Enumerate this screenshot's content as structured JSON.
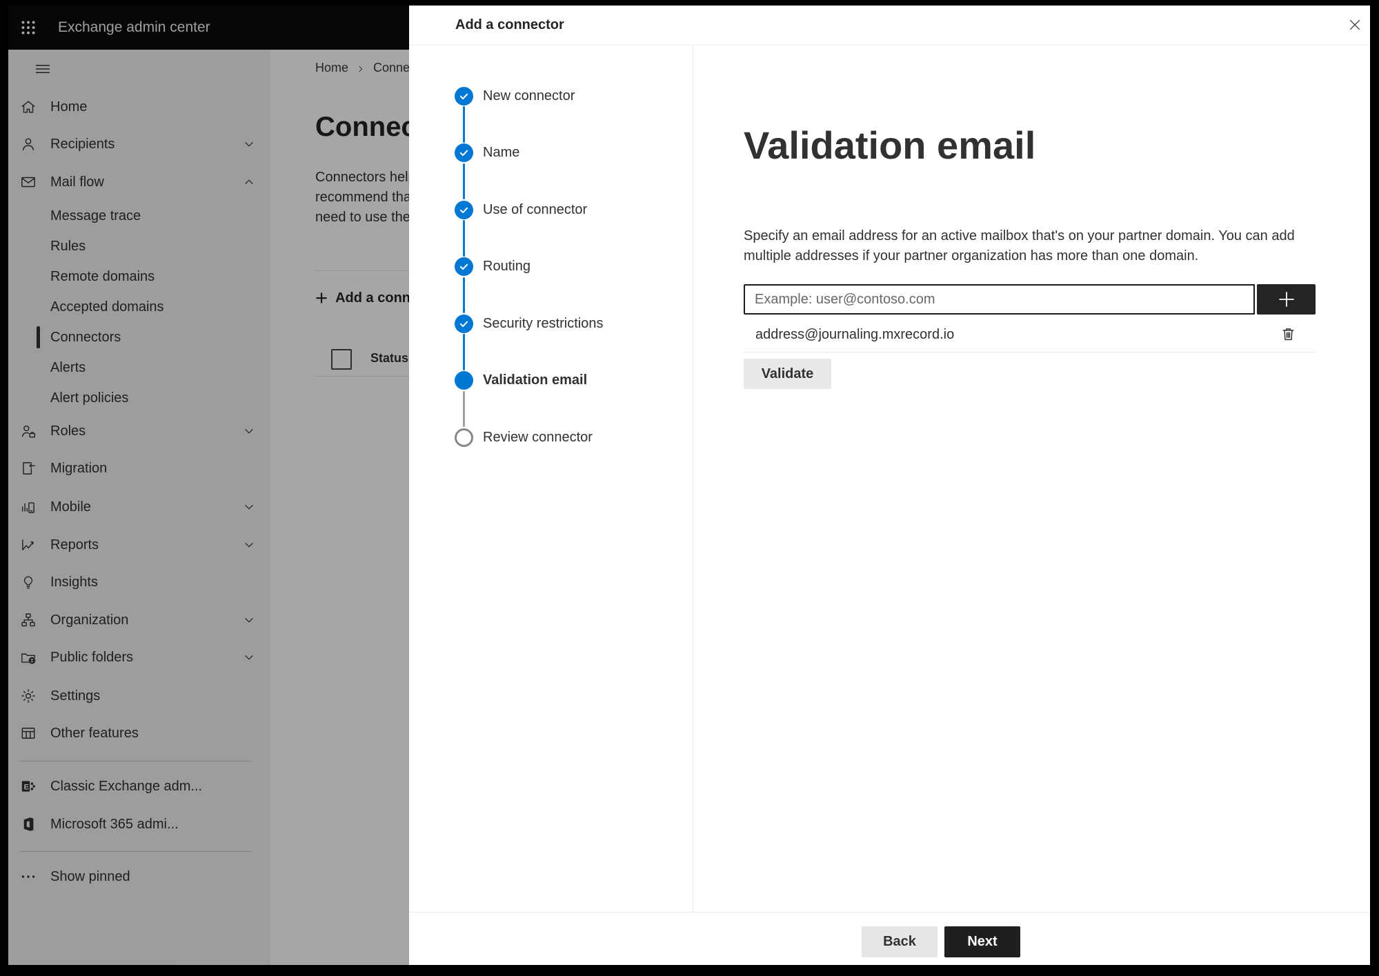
{
  "topbar": {
    "title": "Exchange admin center"
  },
  "sidebar": {
    "items": [
      {
        "label": "Home",
        "icon": "home-icon",
        "type": "main"
      },
      {
        "label": "Recipients",
        "icon": "recipients-icon",
        "type": "main",
        "chevron": "down"
      },
      {
        "label": "Mail flow",
        "icon": "mail-flow-icon",
        "type": "main",
        "chevron": "up"
      },
      {
        "label": "Message trace",
        "type": "sub"
      },
      {
        "label": "Rules",
        "type": "sub"
      },
      {
        "label": "Remote domains",
        "type": "sub"
      },
      {
        "label": "Accepted domains",
        "type": "sub"
      },
      {
        "label": "Connectors",
        "type": "sub",
        "selected": true
      },
      {
        "label": "Alerts",
        "type": "sub"
      },
      {
        "label": "Alert policies",
        "type": "sub"
      },
      {
        "label": "Roles",
        "icon": "roles-icon",
        "type": "main",
        "chevron": "down"
      },
      {
        "label": "Migration",
        "icon": "migration-icon",
        "type": "main"
      },
      {
        "label": "Mobile",
        "icon": "mobile-icon",
        "type": "main",
        "chevron": "down"
      },
      {
        "label": "Reports",
        "icon": "reports-icon",
        "type": "main",
        "chevron": "down"
      },
      {
        "label": "Insights",
        "icon": "insights-icon",
        "type": "main"
      },
      {
        "label": "Organization",
        "icon": "organization-icon",
        "type": "main",
        "chevron": "down"
      },
      {
        "label": "Public folders",
        "icon": "public-folders-icon",
        "type": "main",
        "chevron": "down"
      },
      {
        "label": "Settings",
        "icon": "settings-icon",
        "type": "main"
      },
      {
        "label": "Other features",
        "icon": "other-features-icon",
        "type": "main"
      }
    ],
    "footer_items": [
      {
        "label": "Classic Exchange adm...",
        "icon": "classic-exchange-icon"
      },
      {
        "label": "Microsoft 365 admi...",
        "icon": "microsoft-365-icon"
      },
      {
        "label": "Show pinned",
        "icon": "show-pinned-icon"
      }
    ]
  },
  "background_page": {
    "breadcrumb_home": "Home",
    "breadcrumb_current": "Connectors",
    "heading": "Connectors",
    "paragraph_lines": [
      "Connectors help route email",
      "recommend that you don't create",
      "need to use them for specific"
    ],
    "add_button_label": "Add a connector",
    "status_header": "Status"
  },
  "dialog": {
    "title": "Add a connector",
    "steps": [
      {
        "label": "New connector",
        "state": "completed"
      },
      {
        "label": "Name",
        "state": "completed"
      },
      {
        "label": "Use of connector",
        "state": "completed"
      },
      {
        "label": "Routing",
        "state": "completed"
      },
      {
        "label": "Security restrictions",
        "state": "completed"
      },
      {
        "label": "Validation email",
        "state": "current"
      },
      {
        "label": "Review connector",
        "state": "upcoming"
      }
    ],
    "content": {
      "heading": "Validation email",
      "description_line1": "Specify an email address for an active mailbox that's on your partner domain. You can add",
      "description_line2": "multiple addresses if your partner organization has more than one domain.",
      "input_placeholder": "Example: user@contoso.com",
      "email_address": "address@journaling.mxrecord.io",
      "validate_button": "Validate"
    },
    "footer": {
      "back_button": "Back",
      "next_button": "Next"
    }
  },
  "colors": {
    "accent_blue": "#0078d4",
    "step_upcoming_gray": "#8a8886",
    "topbar_bg": "#0b0b0b",
    "next_button_bg": "#201f1e",
    "sidebar_bg": "#f3f2f1"
  }
}
